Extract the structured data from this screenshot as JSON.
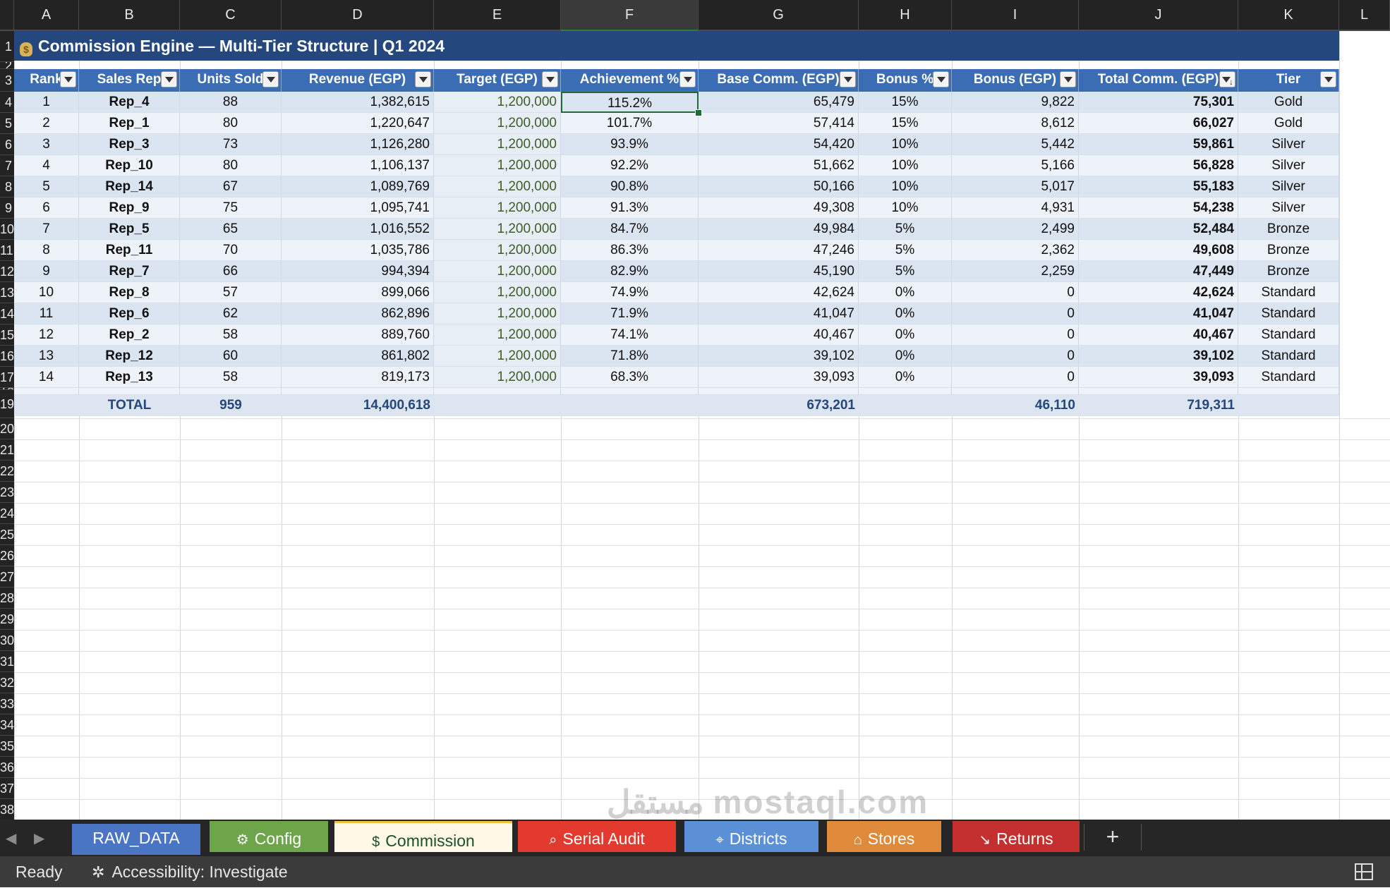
{
  "columns": [
    "A",
    "B",
    "C",
    "D",
    "E",
    "F",
    "G",
    "H",
    "I",
    "J",
    "K",
    "L"
  ],
  "active_column": "F",
  "row_numbers": [
    "1",
    "2",
    "3",
    "4",
    "5",
    "6",
    "7",
    "8",
    "9",
    "10",
    "11",
    "12",
    "13",
    "14",
    "15",
    "16",
    "17",
    "18",
    "19",
    "20",
    "21",
    "22",
    "23",
    "24",
    "25",
    "26",
    "27",
    "28",
    "29",
    "30",
    "31",
    "32",
    "33",
    "34",
    "35",
    "36",
    "37",
    "38"
  ],
  "banner": {
    "icon": "money-bag-icon",
    "title": "Commission Engine  —  Multi-Tier Structure  |  Q1 2024"
  },
  "table": {
    "headers": [
      "Rank",
      "Sales Rep",
      "Units Sold",
      "Revenue (EGP)",
      "Target (EGP)",
      "Achievement %",
      "Base Comm. (EGP)",
      "Bonus %",
      "Bonus (EGP)",
      "Total Comm. (EGP)",
      "Tier"
    ],
    "rows": [
      [
        "1",
        "Rep_4",
        "88",
        "1,382,615",
        "1,200,000",
        "115.2%",
        "65,479",
        "15%",
        "9,822",
        "75,301",
        "Gold"
      ],
      [
        "2",
        "Rep_1",
        "80",
        "1,220,647",
        "1,200,000",
        "101.7%",
        "57,414",
        "15%",
        "8,612",
        "66,027",
        "Gold"
      ],
      [
        "3",
        "Rep_3",
        "73",
        "1,126,280",
        "1,200,000",
        "93.9%",
        "54,420",
        "10%",
        "5,442",
        "59,861",
        "Silver"
      ],
      [
        "4",
        "Rep_10",
        "80",
        "1,106,137",
        "1,200,000",
        "92.2%",
        "51,662",
        "10%",
        "5,166",
        "56,828",
        "Silver"
      ],
      [
        "5",
        "Rep_14",
        "67",
        "1,089,769",
        "1,200,000",
        "90.8%",
        "50,166",
        "10%",
        "5,017",
        "55,183",
        "Silver"
      ],
      [
        "6",
        "Rep_9",
        "75",
        "1,095,741",
        "1,200,000",
        "91.3%",
        "49,308",
        "10%",
        "4,931",
        "54,238",
        "Silver"
      ],
      [
        "7",
        "Rep_5",
        "65",
        "1,016,552",
        "1,200,000",
        "84.7%",
        "49,984",
        "5%",
        "2,499",
        "52,484",
        "Bronze"
      ],
      [
        "8",
        "Rep_11",
        "70",
        "1,035,786",
        "1,200,000",
        "86.3%",
        "47,246",
        "5%",
        "2,362",
        "49,608",
        "Bronze"
      ],
      [
        "9",
        "Rep_7",
        "66",
        "994,394",
        "1,200,000",
        "82.9%",
        "45,190",
        "5%",
        "2,259",
        "47,449",
        "Bronze"
      ],
      [
        "10",
        "Rep_8",
        "57",
        "899,066",
        "1,200,000",
        "74.9%",
        "42,624",
        "0%",
        "0",
        "42,624",
        "Standard"
      ],
      [
        "11",
        "Rep_6",
        "62",
        "862,896",
        "1,200,000",
        "71.9%",
        "41,047",
        "0%",
        "0",
        "41,047",
        "Standard"
      ],
      [
        "12",
        "Rep_2",
        "58",
        "889,760",
        "1,200,000",
        "74.1%",
        "40,467",
        "0%",
        "0",
        "40,467",
        "Standard"
      ],
      [
        "13",
        "Rep_12",
        "60",
        "861,802",
        "1,200,000",
        "71.8%",
        "39,102",
        "0%",
        "0",
        "39,102",
        "Standard"
      ],
      [
        "14",
        "Rep_13",
        "58",
        "819,173",
        "1,200,000",
        "68.3%",
        "39,093",
        "0%",
        "0",
        "39,093",
        "Standard"
      ]
    ],
    "total": {
      "label": "TOTAL",
      "units": "959",
      "revenue": "14,400,618",
      "base_comm": "673,201",
      "bonus": "46,110",
      "total_comm": "719,311"
    }
  },
  "sheet_tabs": [
    {
      "label": "RAW_DATA",
      "icon": "",
      "color": "#4a74c4"
    },
    {
      "label": "Config",
      "icon": "gear-icon",
      "color": "#6ea54a"
    },
    {
      "label": "Commission",
      "icon": "money-bag-icon",
      "color": "#fff8e6",
      "active": true
    },
    {
      "label": "Serial Audit",
      "icon": "magnifier-icon",
      "color": "#e23a2f"
    },
    {
      "label": "Districts",
      "icon": "pin-icon",
      "color": "#5b8fd6"
    },
    {
      "label": "Stores",
      "icon": "store-icon",
      "color": "#e08a3c"
    },
    {
      "label": "Returns",
      "icon": "chart-down-icon",
      "color": "#c43030"
    }
  ],
  "status": {
    "ready": "Ready",
    "accessibility": "Accessibility: Investigate"
  },
  "watermark": "مستقل mostaql.com",
  "colors": {
    "banner": "#24477e",
    "header": "#3a6db3",
    "row_even": "#dbe4f1",
    "row_odd": "#eef3fa",
    "selection": "#1f6b36"
  }
}
